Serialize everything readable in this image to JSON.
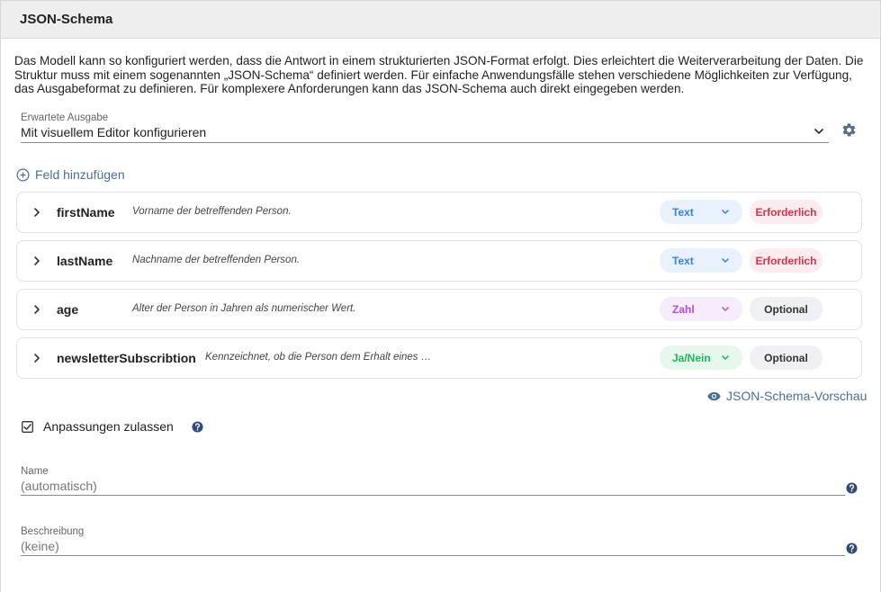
{
  "panel": {
    "title": "JSON-Schema",
    "intro": "Das Modell kann so konfiguriert werden, dass die Antwort in einem strukturierten JSON-Format erfolgt. Dies erleichtert die Weiterverarbeitung der Daten. Die Struktur muss mit einem sogenannten „JSON-Schema“ definiert werden. Für einfache Anwendungsfälle stehen verschiedene Möglichkeiten zur Verfügung, das Ausgabeformat zu definieren. Für komplexere Anforderungen kann das JSON-Schema auch direkt eingegeben werden."
  },
  "output_select": {
    "label": "Erwartete Ausgabe",
    "value": "Mit visuellem Editor konfigurieren"
  },
  "add_field_label": "Feld hinzufügen",
  "fields": [
    {
      "name": "firstName",
      "description": "Vorname der betreffenden Person.",
      "type": "Text",
      "requirement": "Erforderlich"
    },
    {
      "name": "lastName",
      "description": "Nachname der betreffenden Person.",
      "type": "Text",
      "requirement": "Erforderlich"
    },
    {
      "name": "age",
      "description": "Alter der Person in Jahren als numerischer Wert.",
      "type": "Zahl",
      "requirement": "Optional"
    },
    {
      "name": "newsletterSubscribtion",
      "description": "Kennzeichnet, ob die Person dem Erhalt eines …",
      "type": "Ja/Nein",
      "requirement": "Optional"
    }
  ],
  "preview_label": "JSON-Schema-Vorschau",
  "allow_adjustments": {
    "label": "Anpassungen zulassen",
    "checked": true
  },
  "name_field": {
    "label": "Name",
    "value": "(automatisch)"
  },
  "description_field": {
    "label": "Beschreibung",
    "value": "(keine)"
  },
  "colors": {
    "accent": "#4a6f95",
    "text_pill_bg": "#e8f1fc",
    "text_pill_fg": "#3b82d6",
    "number_pill_bg": "#f6ecfb",
    "number_pill_fg": "#b14fd6",
    "bool_pill_bg": "#e6f8ec",
    "bool_pill_fg": "#22b45a",
    "required_bg": "#fdecef",
    "required_fg": "#d8334a",
    "optional_bg": "#eef0f3",
    "optional_fg": "#333333",
    "help_icon": "#304a7c"
  }
}
